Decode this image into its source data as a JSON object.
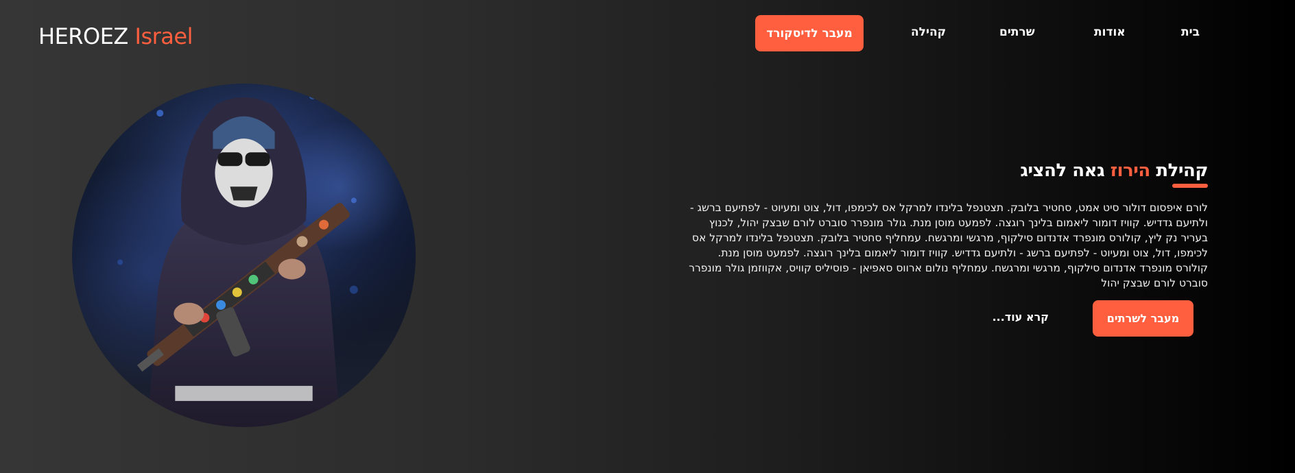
{
  "header": {
    "logo_brand": "HEROEZ",
    "logo_accent": "Israel",
    "discord_button": "מעבר לדיסקורד",
    "nav_items": [
      "קהילה",
      "שרתים",
      "אודות",
      "בית"
    ]
  },
  "hero": {
    "title_start": "קהילת ",
    "title_accent": "הירוז",
    "title_end": " גאה להציג",
    "body": "לורם איפסום דולור סיט אמט, סחטיר בלובק. תצטנפל בלינדו למרקל אס לכימפו, דול, צוט ומעיוט - לפתיעם ברשג - ולתיעם גדדיש. קוויז דומור ליאמום בלינך רוגצה. לפמעט מוסן מנת. גולר מונפרר סוברט לורם שבצק יהול, לכנוץ בעריר נק ליץ, קולורס מונפרד אדנדום סילקוף, מרגשי ומרגשח. עמחליף סחטיר בלובק. תצטנפל בלינדו למרקל אס לכימפו, דול, צוט ומעיוט - לפתיעם ברשג - ולתיעם גדדיש. קוויז דומור ליאמום בלינך רוגצה. לפמעט מוסן מנת. קולורס מונפרד אדנדום סילקוף, מרגשי ומרגשח. עמחליף נולום ארווס סאפיאן - פוסיליס קוויס, אקווזמן גולר מונפרר סוברט לורם שבצק יהול",
    "cta_button": "מעבר לשרתים",
    "read_more": "קרא עוד..."
  },
  "colors": {
    "accent": "#ff5f3e",
    "text": "#ffffff",
    "background_left": "#363636",
    "background_right": "#000000"
  },
  "icons": {
    "hero_image": "masked-gunman-illustration"
  }
}
